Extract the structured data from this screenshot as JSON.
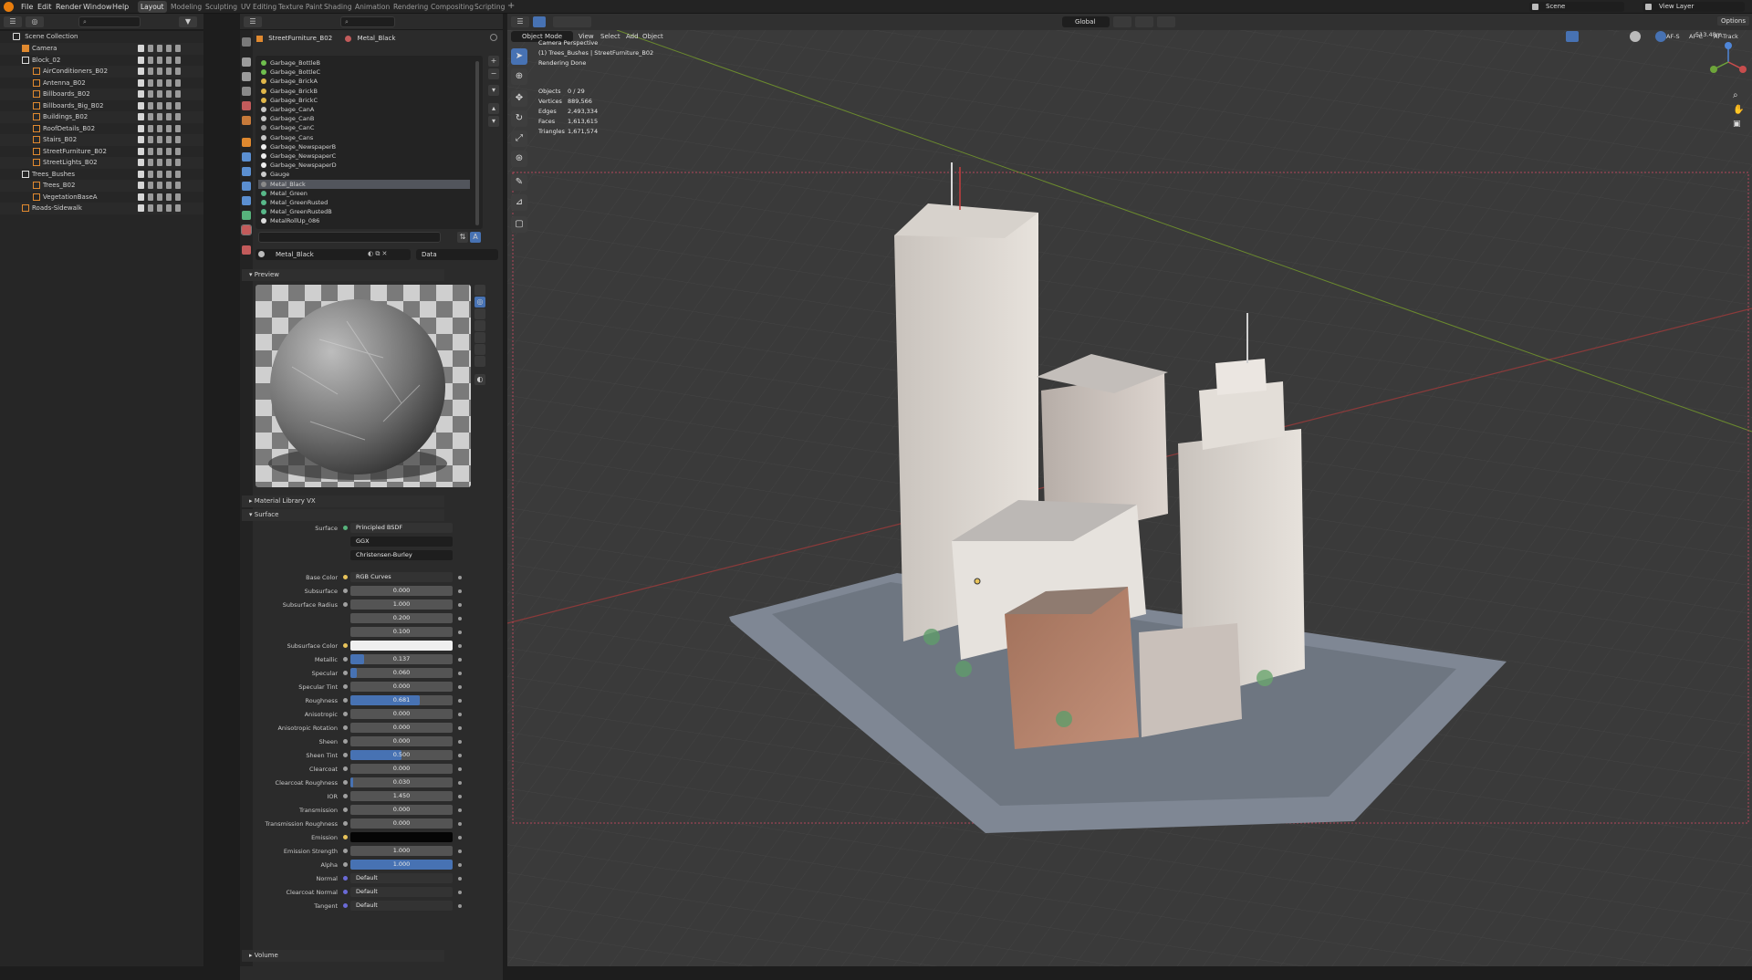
{
  "topbar": {
    "menus": [
      "File",
      "Edit",
      "Render",
      "Window",
      "Help"
    ],
    "workspaces": [
      "Layout",
      "Modeling",
      "Sculpting",
      "UV Editing",
      "Texture Paint",
      "Shading",
      "Animation",
      "Rendering",
      "Compositing",
      "Scripting"
    ],
    "active_workspace": "Layout",
    "scene": "Scene",
    "view_layer": "View Layer"
  },
  "outliner": {
    "header_search_placeholder": "",
    "root": "Scene Collection",
    "rows": [
      {
        "label": "Camera",
        "icon": "camera-icon"
      },
      {
        "label": "Block_02",
        "icon": "collection-icon"
      },
      {
        "label": "AirConditioners_B02",
        "icon": "object-icon"
      },
      {
        "label": "Antenna_B02",
        "icon": "object-icon"
      },
      {
        "label": "Billboards_B02",
        "icon": "object-icon"
      },
      {
        "label": "Billboards_Big_B02",
        "icon": "object-icon"
      },
      {
        "label": "Buildings_B02",
        "icon": "object-icon"
      },
      {
        "label": "RoofDetails_B02",
        "icon": "object-icon"
      },
      {
        "label": "Stairs_B02",
        "icon": "object-icon"
      },
      {
        "label": "StreetFurniture_B02",
        "icon": "object-icon"
      },
      {
        "label": "StreetLights_B02",
        "icon": "object-icon"
      },
      {
        "label": "Trees_Bushes",
        "icon": "collection-icon"
      },
      {
        "label": "Trees_B02",
        "icon": "object-icon"
      },
      {
        "label": "VegetationBaseA",
        "icon": "object-icon"
      },
      {
        "label": "Roads-Sidewalk",
        "icon": "object-icon"
      }
    ]
  },
  "properties": {
    "object_name": "StreetFurniture_B02",
    "material_name": "Metal_Black",
    "materials": [
      "Garbage_BottleB",
      "Garbage_BottleC",
      "Garbage_BrickA",
      "Garbage_BrickB",
      "Garbage_BrickC",
      "Garbage_CanA",
      "Garbage_CanB",
      "Garbage_CanC",
      "Garbage_Cans",
      "Garbage_NewspaperB",
      "Garbage_NewspaperC",
      "Garbage_NewspaperD",
      "Gauge",
      "Metal_Black",
      "Metal_Green",
      "Metal_GreenRusted",
      "Metal_GreenRustedB",
      "MetalRollUp_086"
    ],
    "selected_material": "Metal_Black",
    "slot_material": "Metal_Black",
    "link": "Data",
    "preview_label": "Preview",
    "material_library_label": "Material Library VX",
    "surface_label": "Surface",
    "volume_label": "Volume",
    "surface_shader": "Principled BSDF",
    "distribution": "GGX",
    "subsurface_method": "Christensen-Burley",
    "params": [
      {
        "label": "Base Color",
        "value": "RGB Curves",
        "type": "link"
      },
      {
        "label": "Subsurface",
        "value": "0.000",
        "fill": 0
      },
      {
        "label": "Subsurface Radius",
        "value": "1.000",
        "fill": 0
      },
      {
        "label": "",
        "value": "0.200",
        "fill": 0
      },
      {
        "label": "",
        "value": "0.100",
        "fill": 0
      },
      {
        "label": "Subsurface Color",
        "value": "",
        "type": "color",
        "color": "#efefef"
      },
      {
        "label": "Metallic",
        "value": "0.137",
        "fill": 0.137
      },
      {
        "label": "Specular",
        "value": "0.060",
        "fill": 0.06
      },
      {
        "label": "Specular Tint",
        "value": "0.000",
        "fill": 0
      },
      {
        "label": "Roughness",
        "value": "0.681",
        "fill": 0.681
      },
      {
        "label": "Anisotropic",
        "value": "0.000",
        "fill": 0
      },
      {
        "label": "Anisotropic Rotation",
        "value": "0.000",
        "fill": 0
      },
      {
        "label": "Sheen",
        "value": "0.000",
        "fill": 0
      },
      {
        "label": "Sheen Tint",
        "value": "0.500",
        "fill": 0.5
      },
      {
        "label": "Clearcoat",
        "value": "0.000",
        "fill": 0
      },
      {
        "label": "Clearcoat Roughness",
        "value": "0.030",
        "fill": 0.03
      },
      {
        "label": "IOR",
        "value": "1.450",
        "fill": 0
      },
      {
        "label": "Transmission",
        "value": "0.000",
        "fill": 0
      },
      {
        "label": "Transmission Roughness",
        "value": "0.000",
        "fill": 0
      },
      {
        "label": "Emission",
        "value": "",
        "type": "color",
        "color": "#050505"
      },
      {
        "label": "Emission Strength",
        "value": "1.000",
        "fill": 0
      },
      {
        "label": "Alpha",
        "value": "1.000",
        "fill": 1
      },
      {
        "label": "Normal",
        "value": "Default",
        "type": "link"
      },
      {
        "label": "Clearcoat Normal",
        "value": "Default",
        "type": "link"
      },
      {
        "label": "Tangent",
        "value": "Default",
        "type": "link"
      }
    ]
  },
  "viewport": {
    "mode": "Object Mode",
    "menus": [
      "View",
      "Select",
      "Add",
      "Object"
    ],
    "orientation": "Global",
    "camera_label": "Camera Perspective",
    "context": "(1) Trees_Bushes | StreetFurniture_B02",
    "render_status": "Rendering Done",
    "stats": [
      {
        "label": "Objects",
        "value": "0 / 29"
      },
      {
        "label": "Vertices",
        "value": "889,566"
      },
      {
        "label": "Edges",
        "value": "2,493,334"
      },
      {
        "label": "Faces",
        "value": "1,613,615"
      },
      {
        "label": "Triangles",
        "value": "1,671,574"
      }
    ],
    "af_labels": [
      "AF-S",
      "AF-C",
      "AF-Track"
    ],
    "distance": "513.48m",
    "options_label": "Options"
  }
}
